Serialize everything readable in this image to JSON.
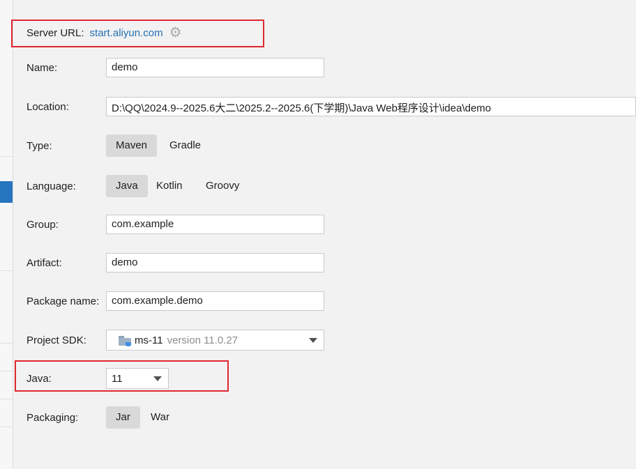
{
  "server_url": {
    "label": "Server URL:",
    "value": "start.aliyun.com",
    "settings_icon": "gear-icon"
  },
  "fields": {
    "name": {
      "label": "Name:",
      "value": "demo"
    },
    "location": {
      "label": "Location:",
      "value": "D:\\QQ\\2024.9--2025.6大二\\2025.2--2025.6(下学期)\\Java Web程序设计\\idea\\demo"
    },
    "group": {
      "label": "Group:",
      "value": "com.example"
    },
    "artifact": {
      "label": "Artifact:",
      "value": "demo"
    },
    "package_name": {
      "label": "Package name:",
      "value": "com.example.demo"
    }
  },
  "type": {
    "label": "Type:",
    "options": [
      "Maven",
      "Gradle"
    ],
    "selected": "Maven"
  },
  "language": {
    "label": "Language:",
    "options": [
      "Java",
      "Kotlin",
      "Groovy"
    ],
    "selected": "Java"
  },
  "project_sdk": {
    "label": "Project SDK:",
    "name": "ms-11",
    "version": "version 11.0.27",
    "icon": "jdk-folder-icon"
  },
  "java": {
    "label": "Java:",
    "value": "11"
  },
  "packaging": {
    "label": "Packaging:",
    "options": [
      "Jar",
      "War"
    ],
    "selected": "Jar"
  },
  "colors": {
    "link": "#2470b3",
    "highlight_box": "#e0262f",
    "selected_segment": "#d9d9d9",
    "sidebar_selection": "#2675bf"
  }
}
